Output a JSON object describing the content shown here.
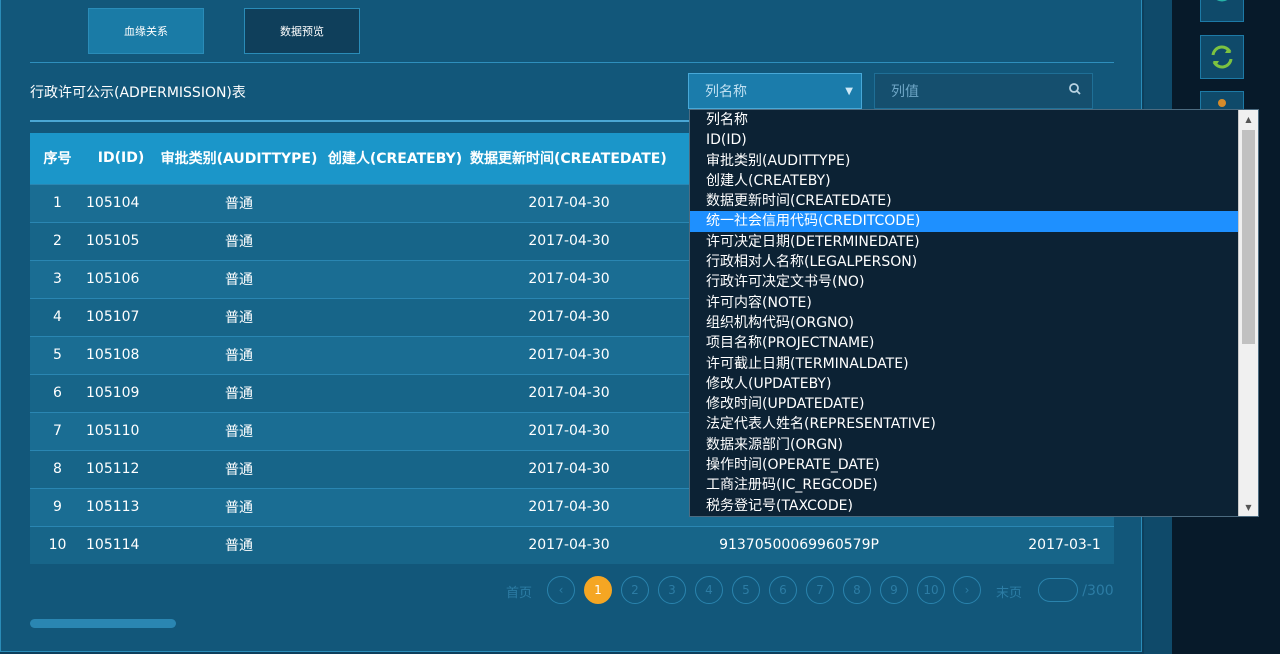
{
  "tabs": [
    {
      "label": "血缘关系"
    },
    {
      "label": "数据预览"
    }
  ],
  "table_title": "行政许可公示(ADPERMISSION)表",
  "filter": {
    "column_select_value": "列名称",
    "value_placeholder": "列值"
  },
  "table": {
    "headers": [
      "序号",
      "ID(ID)",
      "审批类别(AUDITTYPE)",
      "创建人(CREATEBY)",
      "数据更新时间(CREATEDATE)",
      "",
      ""
    ],
    "rows": [
      [
        "1",
        "105104",
        "普通",
        "",
        "2017-04-30",
        "",
        ""
      ],
      [
        "2",
        "105105",
        "普通",
        "",
        "2017-04-30",
        "",
        ""
      ],
      [
        "3",
        "105106",
        "普通",
        "",
        "2017-04-30",
        "",
        ""
      ],
      [
        "4",
        "105107",
        "普通",
        "",
        "2017-04-30",
        "",
        ""
      ],
      [
        "5",
        "105108",
        "普通",
        "",
        "2017-04-30",
        "",
        ""
      ],
      [
        "6",
        "105109",
        "普通",
        "",
        "2017-04-30",
        "",
        ""
      ],
      [
        "7",
        "105110",
        "普通",
        "",
        "2017-04-30",
        "",
        ""
      ],
      [
        "8",
        "105112",
        "普通",
        "",
        "2017-04-30",
        "",
        ""
      ],
      [
        "9",
        "105113",
        "普通",
        "",
        "2017-04-30",
        "",
        ""
      ],
      [
        "10",
        "105114",
        "普通",
        "",
        "2017-04-30",
        "91370500069960579P",
        "2017-03-1"
      ]
    ]
  },
  "pagination": {
    "first_label": "首页",
    "last_label": "末页",
    "prev_icon": "chevron-left-icon",
    "next_icon": "chevron-right-icon",
    "pages": [
      "1",
      "2",
      "3",
      "4",
      "5",
      "6",
      "7",
      "8",
      "9",
      "10"
    ],
    "current_page": "1",
    "total_label": "/300"
  },
  "dropdown": {
    "options": [
      "列名称",
      "ID(ID)",
      "审批类别(AUDITTYPE)",
      "创建人(CREATEBY)",
      "数据更新时间(CREATEDATE)",
      "统一社会信用代码(CREDITCODE)",
      "许可决定日期(DETERMINEDATE)",
      "行政相对人名称(LEGALPERSON)",
      "行政许可决定文书号(NO)",
      "许可内容(NOTE)",
      "组织机构代码(ORGNO)",
      "项目名称(PROJECTNAME)",
      "许可截止日期(TERMINALDATE)",
      "修改人(UPDATEBY)",
      "修改时间(UPDATEDATE)",
      "法定代表人姓名(REPRESENTATIVE)",
      "数据来源部门(ORGN)",
      "操作时间(OPERATE_DATE)",
      "工商注册码(IC_REGCODE)",
      "税务登记号(TAXCODE)"
    ],
    "highlighted": "统一社会信用代码(CREDITCODE)"
  },
  "icons": {
    "search": "search-icon",
    "dropdown_arrow": "caret-down-icon",
    "refresh": "refresh-icon",
    "signal": "signal-icon"
  },
  "colors": {
    "accent_active_page": "#f5a623",
    "header_bg": "#1b96c9",
    "highlight": "#1e90ff"
  }
}
